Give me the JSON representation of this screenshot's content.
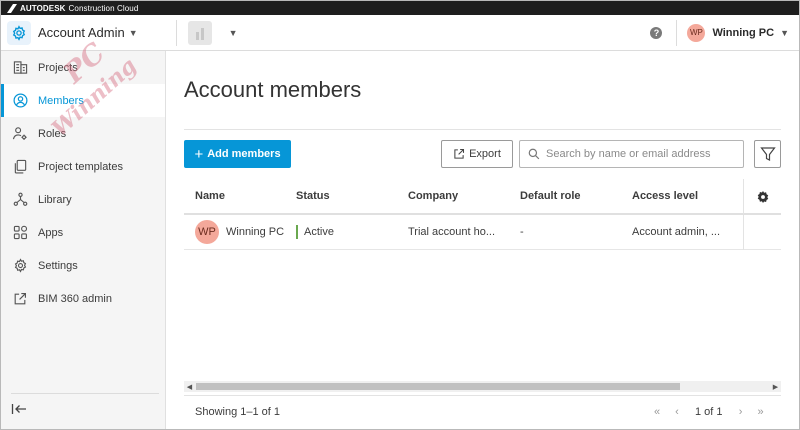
{
  "brandbar": {
    "brand": "AUTODESK",
    "product": "Construction Cloud"
  },
  "header": {
    "app_title": "Account Admin",
    "help_label": "?",
    "user": {
      "initials": "WP",
      "name": "Winning PC"
    }
  },
  "sidebar": {
    "items": [
      {
        "label": "Projects",
        "icon": "projects-icon"
      },
      {
        "label": "Members",
        "icon": "members-icon",
        "active": true
      },
      {
        "label": "Roles",
        "icon": "roles-icon"
      },
      {
        "label": "Project templates",
        "icon": "templates-icon"
      },
      {
        "label": "Library",
        "icon": "library-icon"
      },
      {
        "label": "Apps",
        "icon": "apps-icon"
      },
      {
        "label": "Settings",
        "icon": "settings-icon"
      },
      {
        "label": "BIM 360 admin",
        "icon": "external-link-icon"
      }
    ]
  },
  "main": {
    "title": "Account members",
    "add_button": "Add members",
    "export_button": "Export",
    "search_placeholder": "Search by name or email address",
    "table": {
      "columns": [
        "Name",
        "Status",
        "Company",
        "Default role",
        "Access level"
      ],
      "rows": [
        {
          "initials": "WP",
          "name": "Winning PC",
          "status": "Active",
          "company": "Trial account ho...",
          "default_role": "-",
          "access_level": "Account admin, ..."
        }
      ]
    },
    "footer": {
      "showing": "Showing 1–1 of 1",
      "page": "1 of 1"
    }
  },
  "watermark": {
    "top": "PC",
    "bottom": "Winning"
  },
  "colors": {
    "accent": "#0696d7",
    "active_status": "#6aa84f",
    "avatar": "#f4a89a",
    "brandbar": "#1e1e1e"
  }
}
